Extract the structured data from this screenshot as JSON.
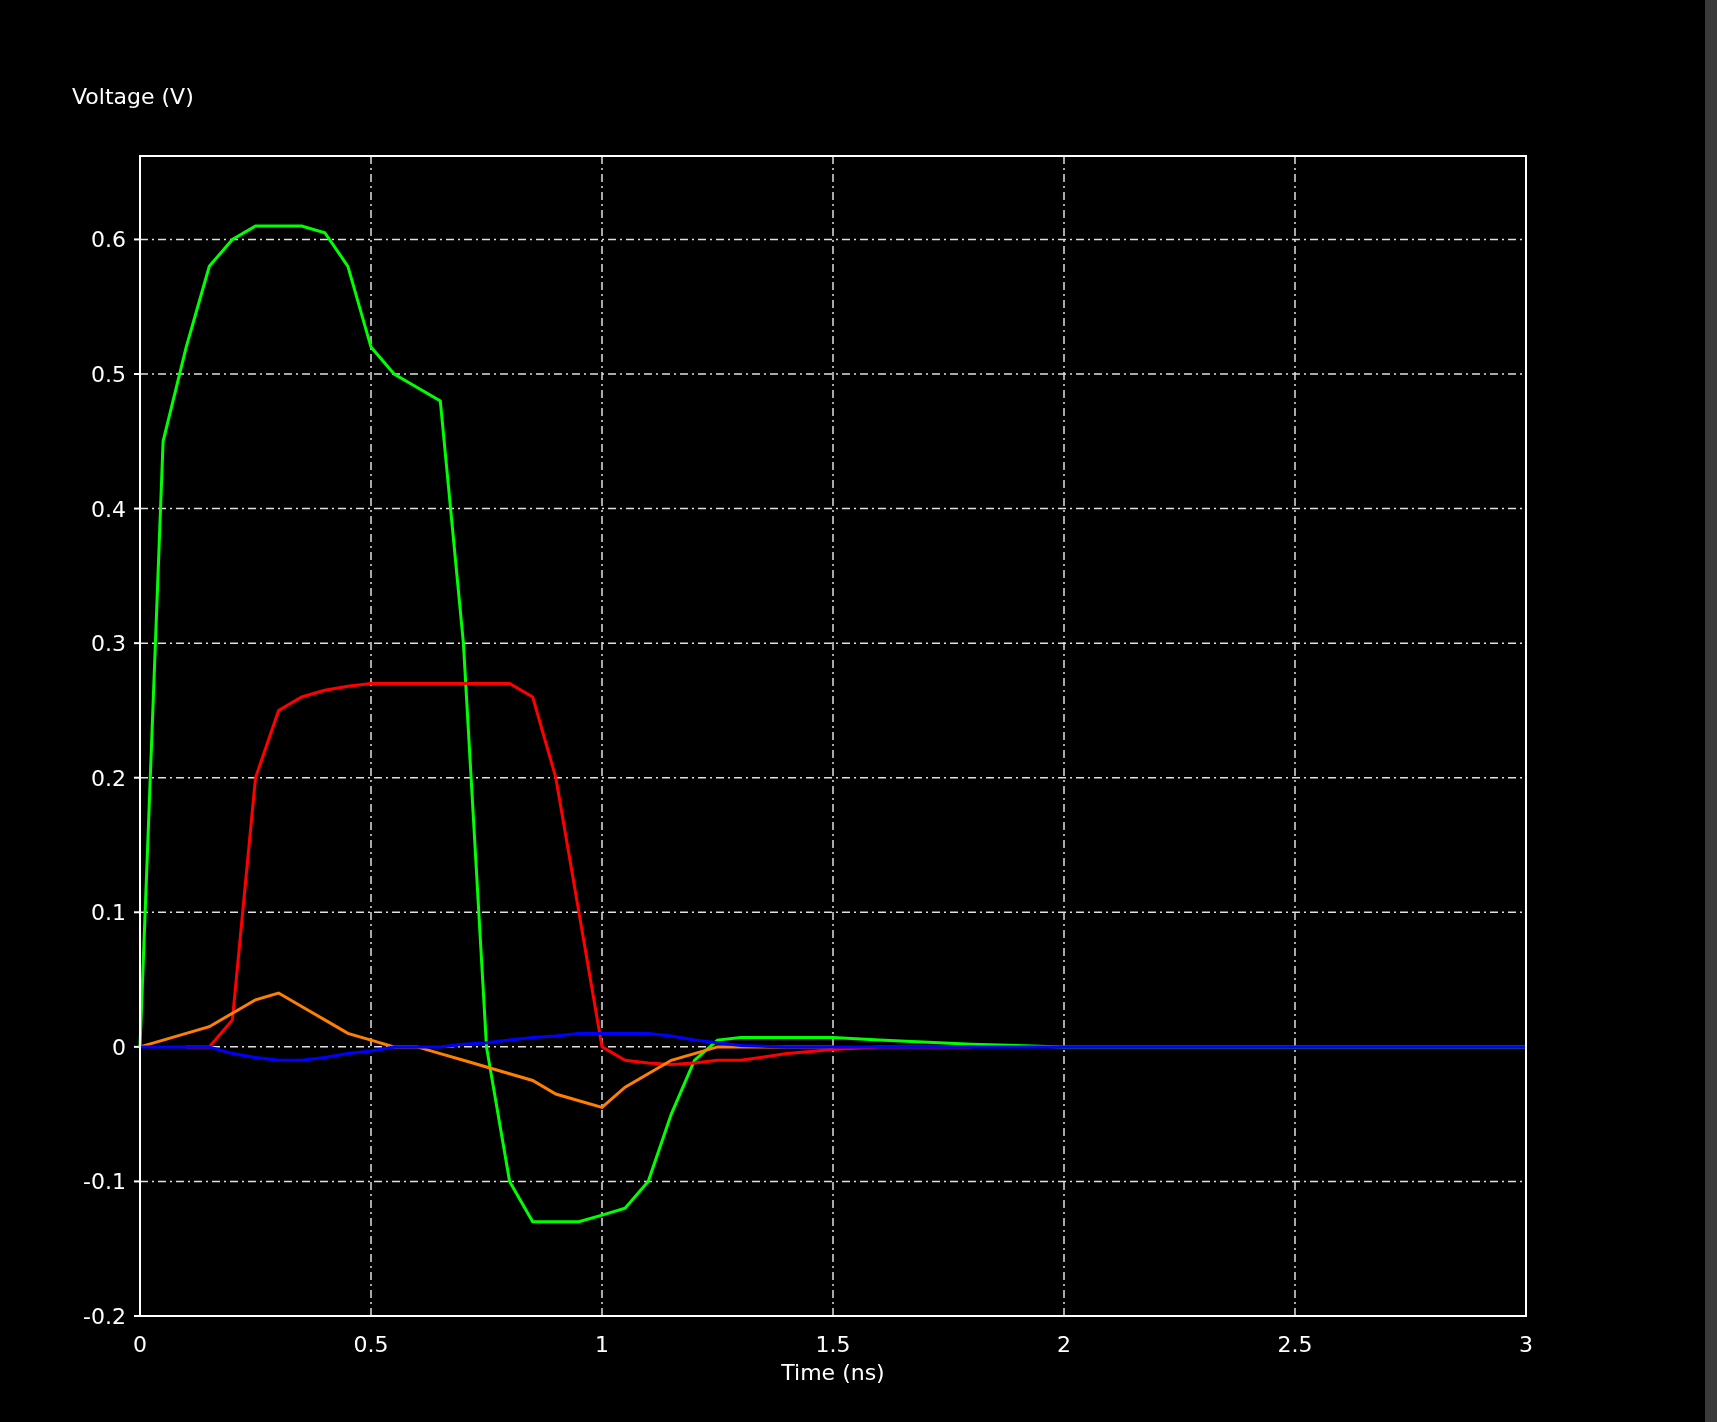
{
  "chart_data": {
    "type": "line",
    "ylabel": "Voltage (V)",
    "xlabel": "Time (ns)",
    "x": [
      0,
      0.05,
      0.1,
      0.15,
      0.2,
      0.25,
      0.3,
      0.35,
      0.4,
      0.45,
      0.5,
      0.55,
      0.6,
      0.65,
      0.7,
      0.75,
      0.8,
      0.85,
      0.9,
      0.95,
      1.0,
      1.05,
      1.1,
      1.15,
      1.2,
      1.25,
      1.3,
      1.4,
      1.5,
      1.6,
      1.8,
      2,
      2.5,
      3
    ],
    "series": [
      {
        "color": "#00ff00",
        "values": [
          0,
          0.45,
          0.52,
          0.58,
          0.6,
          0.61,
          0.61,
          0.61,
          0.605,
          0.58,
          0.52,
          0.5,
          0.49,
          0.48,
          0.3,
          0.0,
          -0.1,
          -0.13,
          -0.13,
          -0.13,
          -0.125,
          -0.12,
          -0.1,
          -0.05,
          -0.01,
          0.005,
          0.007,
          0.007,
          0.007,
          0.005,
          0.002,
          0,
          0,
          0
        ]
      },
      {
        "color": "#ff0000",
        "values": [
          null,
          null,
          0,
          0,
          0.02,
          0.2,
          0.25,
          0.26,
          0.265,
          0.268,
          0.27,
          0.27,
          0.27,
          0.27,
          0.27,
          0.27,
          0.27,
          0.26,
          0.2,
          0.1,
          0.0,
          -0.01,
          -0.012,
          -0.013,
          -0.012,
          -0.01,
          -0.01,
          -0.005,
          -0.002,
          0,
          0,
          null,
          null,
          null
        ]
      },
      {
        "color": "#ff8000",
        "values": [
          0,
          0.005,
          0.01,
          0.015,
          0.025,
          0.035,
          0.04,
          0.03,
          0.02,
          0.01,
          0.005,
          0,
          0,
          -0.005,
          -0.01,
          -0.015,
          -0.02,
          -0.025,
          -0.035,
          -0.04,
          -0.045,
          -0.03,
          -0.02,
          -0.01,
          -0.005,
          0,
          0,
          0,
          0,
          null,
          null,
          null,
          null,
          null
        ]
      },
      {
        "color": "#0000ff",
        "values": [
          0,
          0,
          0,
          0,
          -0.005,
          -0.008,
          -0.01,
          -0.01,
          -0.008,
          -0.005,
          -0.003,
          0,
          0,
          0,
          0.002,
          0.003,
          0.005,
          0.007,
          0.008,
          0.01,
          0.01,
          0.01,
          0.01,
          0.008,
          0.005,
          0.003,
          0.001,
          0,
          0,
          0,
          0,
          0,
          0,
          0
        ]
      }
    ],
    "grid": true,
    "xlim": [
      0,
      3
    ],
    "ylim": [
      -0.2,
      0.662
    ],
    "xticks": [
      0,
      0.5,
      1,
      1.5,
      2,
      2.5,
      3
    ],
    "yticks": [
      -0.2,
      -0.1,
      0,
      0.1,
      0.2,
      0.3,
      0.4,
      0.5,
      0.6
    ]
  }
}
